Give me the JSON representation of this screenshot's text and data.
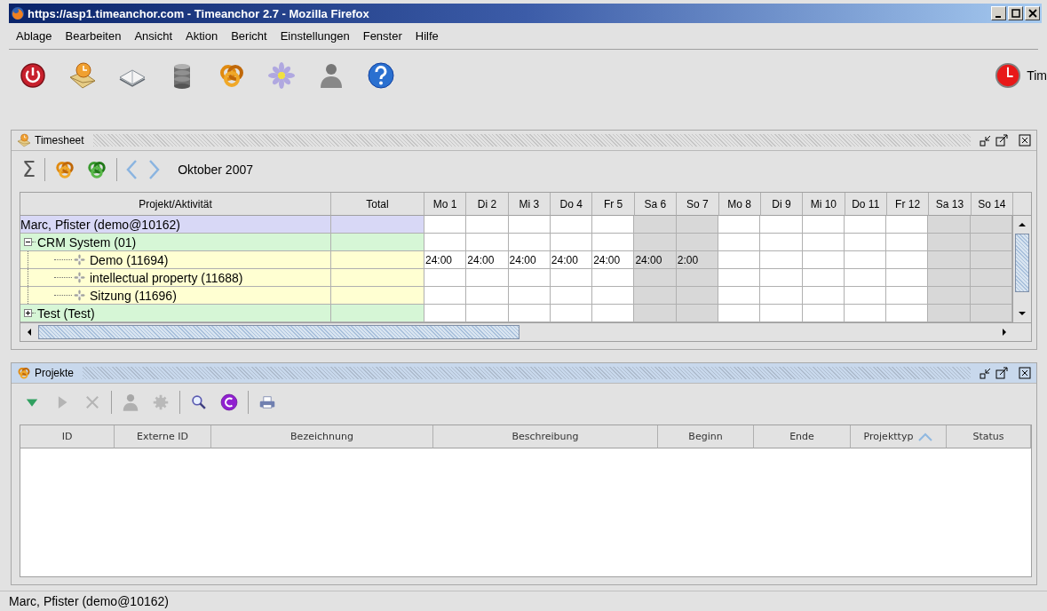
{
  "window": {
    "title": "https://asp1.timeanchor.com - Timeanchor 2.7 - Mozilla Firefox"
  },
  "menu": [
    "Ablage",
    "Bearbeiten",
    "Ansicht",
    "Aktion",
    "Bericht",
    "Einstellungen",
    "Fenster",
    "Hilfe"
  ],
  "toolbar": [
    {
      "kind": "power"
    },
    {
      "kind": "mail"
    },
    {
      "kind": "book"
    },
    {
      "kind": "database"
    },
    {
      "kind": "knot-gold"
    },
    {
      "kind": "flower"
    },
    {
      "kind": "person"
    },
    {
      "kind": "help"
    }
  ],
  "toolbar_right": {
    "kind": "clock",
    "label": "Tim"
  },
  "timesheet": {
    "title": "Timesheet",
    "active": false,
    "toolbar": [
      {
        "kind": "sum",
        "label": "Σ"
      },
      {
        "kind": "separator"
      },
      {
        "kind": "knot-gold"
      },
      {
        "kind": "knot-green"
      },
      {
        "kind": "separator"
      },
      {
        "kind": "prev"
      },
      {
        "kind": "next"
      }
    ],
    "month": "Oktober 2007",
    "columns": {
      "project": "Projekt/Aktivität",
      "total": "Total"
    },
    "days": [
      {
        "label": "Mo 1",
        "weekend": false
      },
      {
        "label": "Di 2",
        "weekend": false
      },
      {
        "label": "Mi 3",
        "weekend": false
      },
      {
        "label": "Do 4",
        "weekend": false
      },
      {
        "label": "Fr 5",
        "weekend": false
      },
      {
        "label": "Sa 6",
        "weekend": true
      },
      {
        "label": "So 7",
        "weekend": true
      },
      {
        "label": "Mo 8",
        "weekend": false
      },
      {
        "label": "Di 9",
        "weekend": false
      },
      {
        "label": "Mi 10",
        "weekend": false
      },
      {
        "label": "Do 11",
        "weekend": false
      },
      {
        "label": "Fr 12",
        "weekend": false
      },
      {
        "label": "Sa 13",
        "weekend": true
      },
      {
        "label": "So 14",
        "weekend": true
      }
    ],
    "rows": [
      {
        "label": "Marc, Pfister  (demo@10162)",
        "kind": "user",
        "children": [
          {
            "label": "CRM System (01)",
            "kind": "project",
            "expanded": true,
            "children": [
              {
                "label": "Demo (11694)",
                "kind": "activity",
                "hours": [
                  "24:00",
                  "24:00",
                  "24:00",
                  "24:00",
                  "24:00",
                  "24:00",
                  "2:00"
                ]
              },
              {
                "label": "intellectual property (11688)",
                "kind": "activity"
              },
              {
                "label": "Sitzung (11696)",
                "kind": "activity"
              }
            ]
          },
          {
            "label": "Test (Test)",
            "kind": "project",
            "expanded": false
          }
        ]
      }
    ]
  },
  "projekte": {
    "title": "Projekte",
    "active": true,
    "toolbar": [
      {
        "kind": "down",
        "disabled": false
      },
      {
        "kind": "play",
        "disabled": true
      },
      {
        "kind": "delete",
        "disabled": true
      },
      {
        "kind": "separator"
      },
      {
        "kind": "person",
        "disabled": true
      },
      {
        "kind": "gear",
        "disabled": true
      },
      {
        "kind": "separator"
      },
      {
        "kind": "search",
        "disabled": false
      },
      {
        "kind": "refresh",
        "disabled": false
      },
      {
        "kind": "separator"
      },
      {
        "kind": "print",
        "disabled": false
      }
    ],
    "columns": [
      {
        "label": "ID",
        "sorted": false
      },
      {
        "label": "Externe ID",
        "sorted": false
      },
      {
        "label": "Bezeichnung",
        "sorted": false
      },
      {
        "label": "Beschreibung",
        "sorted": false
      },
      {
        "label": "Beginn",
        "sorted": false
      },
      {
        "label": "Ende",
        "sorted": false
      },
      {
        "label": "Projekttyp",
        "sorted": true
      },
      {
        "label": "Status",
        "sorted": false
      }
    ]
  },
  "status_bar": "Marc, Pfister  (demo@10162)"
}
